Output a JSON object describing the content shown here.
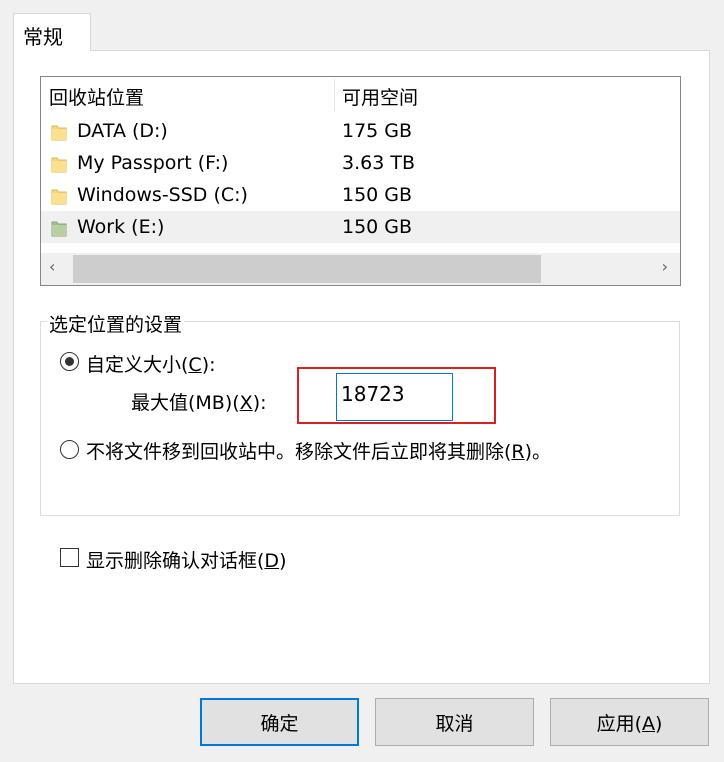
{
  "tab": {
    "label": "常规"
  },
  "list": {
    "col_location": "回收站位置",
    "col_free": "可用空间",
    "rows": [
      {
        "name": "DATA (D:)",
        "free": "175 GB",
        "selected": false
      },
      {
        "name": "My Passport (F:)",
        "free": "3.63 TB",
        "selected": false
      },
      {
        "name": "Windows-SSD (C:)",
        "free": "150 GB",
        "selected": false
      },
      {
        "name": "Work (E:)",
        "free": "150 GB",
        "selected": true
      }
    ],
    "scroll_left_icon": "chevron-left-icon",
    "scroll_right_icon": "chevron-right-icon"
  },
  "settings": {
    "group_title": "选定位置的设置",
    "custom_size": {
      "label": "自定义大小(",
      "key": "C",
      "suffix": "):",
      "checked": true
    },
    "max_value": {
      "label": "最大值(MB)(",
      "key": "X",
      "suffix": "):",
      "value": "18723"
    },
    "no_recycle": {
      "label": "不将文件移到回收站中。移除文件后立即将其删除(",
      "key": "R",
      "suffix": ")。",
      "checked": false
    }
  },
  "confirm": {
    "label": "显示删除确认对话框(",
    "key": "D",
    "suffix": ")",
    "checked": false
  },
  "buttons": {
    "ok": "确定",
    "cancel": "取消",
    "apply_label": "应用(",
    "apply_key": "A",
    "apply_suffix": ")"
  },
  "colors": {
    "highlight_red": "#d9201f",
    "focus_blue": "#0078d7",
    "folder_yellow": "#f8d775",
    "folder_green": "#a4c08e"
  }
}
